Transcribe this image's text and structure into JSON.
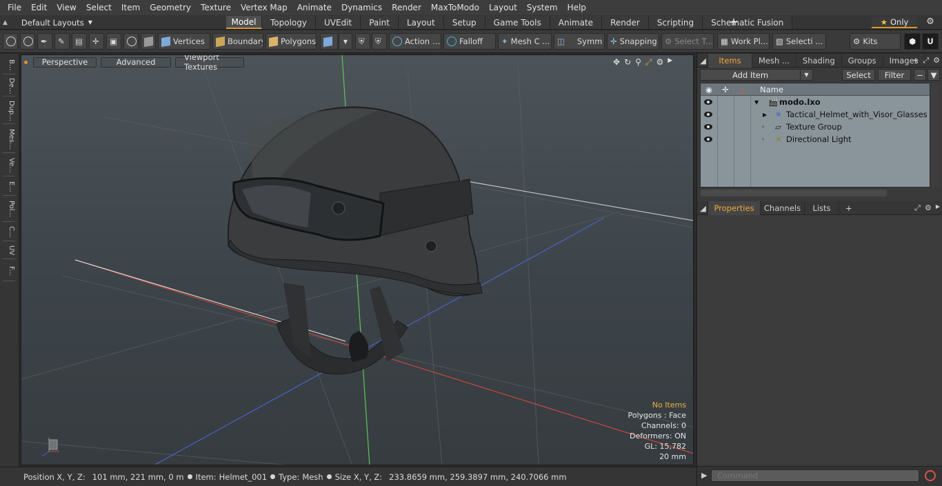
{
  "menu": [
    "File",
    "Edit",
    "View",
    "Select",
    "Item",
    "Geometry",
    "Texture",
    "Vertex Map",
    "Animate",
    "Dynamics",
    "Render",
    "MaxToModo",
    "Layout",
    "System",
    "Help"
  ],
  "layout_selector": "Default Layouts",
  "mode_tabs": [
    "Model",
    "Topology",
    "UVEdit",
    "Paint",
    "Layout",
    "Setup",
    "Game Tools",
    "Animate",
    "Render",
    "Scripting",
    "Schematic Fusion"
  ],
  "active_mode_tab": "Model",
  "only_label": "Only",
  "toolbar": {
    "vertices": "Vertices",
    "boundary": "Boundary",
    "polygons": "Polygons",
    "action": "Action",
    "falloff": "Falloff",
    "mesh_c": "Mesh C ...",
    "symm": "Symm ...",
    "snapping": "Snapping",
    "select_t": "Select T...",
    "work_pl": "Work Pl...",
    "selecti": "Selecti ...",
    "kits": "Kits"
  },
  "left_tabs": [
    "B...",
    "De...",
    "Dup...",
    "Mes...",
    "Ve...",
    "E...",
    "Pol...",
    "C...",
    "UV",
    "F..."
  ],
  "viewport": {
    "perspective": "Perspective",
    "advanced": "Advanced",
    "viewport_textures": "Viewport Textures",
    "info": {
      "no_items": "No Items",
      "polygons": "Polygons : Face",
      "channels": "Channels: 0",
      "deformers": "Deformers: ON",
      "gl": "GL: 15,782",
      "scale": "20 mm"
    }
  },
  "status": {
    "position_label": "Position X, Y, Z:",
    "position_value": "101 mm, 221 mm, 0 m",
    "item_label": "Item:",
    "item_value": "Helmet_001",
    "type_label": "Type:",
    "type_value": "Mesh",
    "size_label": "Size X, Y, Z:",
    "size_value": "233.8659 mm, 259.3897 mm, 240.7066 mm"
  },
  "right_tabs": [
    "Items",
    "Mesh ...",
    "Shading",
    "Groups",
    "Images"
  ],
  "active_right_tab": "Items",
  "items_toolbar": {
    "add_item": "Add Item",
    "select": "Select",
    "filter": "Filter"
  },
  "tree": {
    "header_name": "Name",
    "rows": [
      {
        "name": "modo.lxo",
        "indent": 0
      },
      {
        "name": "Tactical_Helmet_with_Visor_Glasses",
        "indent": 1
      },
      {
        "name": "Texture Group",
        "indent": 1
      },
      {
        "name": "Directional Light",
        "indent": 1
      }
    ]
  },
  "prop_tabs": [
    "Properties",
    "Channels",
    "Lists"
  ],
  "active_prop_tab": "Properties",
  "command_placeholder": "Command",
  "colors": {
    "accent": "#d99a2b",
    "x_axis": "#c9473f",
    "y_axis": "#5fc75a",
    "z_axis": "#4a62c9"
  }
}
